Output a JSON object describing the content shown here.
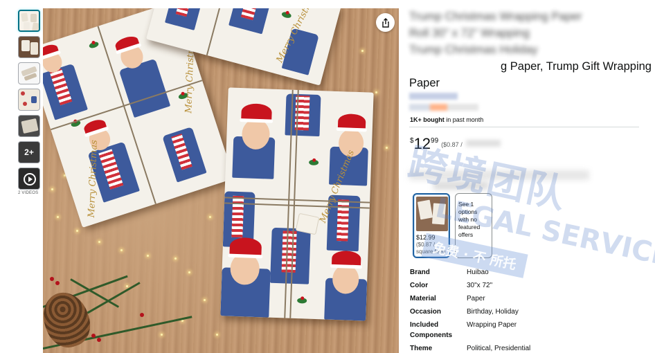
{
  "thumbnails": [
    {
      "type": "image",
      "active": true
    },
    {
      "type": "image",
      "active": false
    },
    {
      "type": "image",
      "active": false
    },
    {
      "type": "image",
      "active": false
    },
    {
      "type": "image",
      "active": false
    },
    {
      "type": "more",
      "label": "2+"
    },
    {
      "type": "video"
    }
  ],
  "videos_label": "2 VIDEOS",
  "main_image": {
    "packages": [
      {
        "greeting": "Merry Christmas"
      },
      {
        "greeting": "Merry Christmas"
      },
      {
        "greeting": "Merry Christmas"
      }
    ]
  },
  "share_icon": "share-icon",
  "product": {
    "title_line1": "Trump Christmas Wrapping Paper",
    "title_line2": "Roll 30\" x 72\" Wrapping",
    "title_line3": "Trump Christmas Holiday",
    "title_line4_visible": "g Paper, Trump Gift Wrapping",
    "title_line5": "Paper",
    "bought": "1K+ bought",
    "bought_suffix": " in past month",
    "price_symbol": "$",
    "price_whole": "12",
    "price_fraction": "99",
    "price_unit": "($0.87 /"
  },
  "swatches": [
    {
      "price": "$12.99",
      "unit": "($0.87 / square feet)",
      "selected": true
    },
    {
      "text": "See 1 options with no featured offers",
      "selected": false
    }
  ],
  "specs": [
    {
      "key": "Brand",
      "value": "Huibao"
    },
    {
      "key": "Color",
      "value": "30\"x 72\""
    },
    {
      "key": "Material",
      "value": "Paper"
    },
    {
      "key": "Occasion",
      "value": "Birthday, Holiday"
    },
    {
      "key": "Included Components",
      "value": "Wrapping Paper"
    },
    {
      "key": "Theme",
      "value": "Political, Presidential"
    }
  ],
  "watermark": {
    "cn": "跨境团队",
    "en": "LEGAL SERVICE",
    "sub": "免费 · 不  所托"
  },
  "colors": {
    "accent": "#007185",
    "swatch_selected": "#2162a1",
    "santa_red": "#c8141e",
    "suit_blue": "#3d5a9c"
  }
}
